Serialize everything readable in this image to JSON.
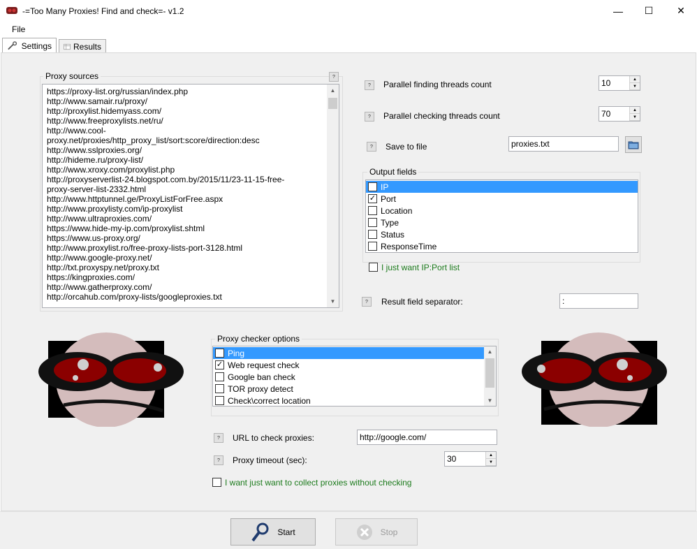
{
  "window": {
    "title": "-=Too Many Proxies! Find and check=- v1.2",
    "minimize": "—",
    "maximize": "☐",
    "close": "✕"
  },
  "menu": {
    "file": "File"
  },
  "tabs": [
    {
      "label": "Settings",
      "icon": "wrench-icon"
    },
    {
      "label": "Results",
      "icon": "table-icon"
    }
  ],
  "help_label": "?",
  "proxy_sources": {
    "label": "Proxy sources",
    "lines": [
      "https://proxy-list.org/russian/index.php",
      "http://www.samair.ru/proxy/",
      "http://proxylist.hidemyass.com/",
      "http://www.freeproxylists.net/ru/",
      "http://www.cool-",
      "proxy.net/proxies/http_proxy_list/sort:score/direction:desc",
      "http://www.sslproxies.org/",
      "http://hideme.ru/proxy-list/",
      "http://www.xroxy.com/proxylist.php",
      "http://proxyserverlist-24.blogspot.com.by/2015/11/23-11-15-free-",
      "proxy-server-list-2332.html",
      "http://www.httptunnel.ge/ProxyListForFree.aspx",
      "http://www.proxylisty.com/ip-proxylist",
      "http://www.ultraproxies.com/",
      "https://www.hide-my-ip.com/proxylist.shtml",
      "https://www.us-proxy.org/",
      "http://www.proxylist.ro/free-proxy-lists-port-3128.html",
      "http://www.google-proxy.net/",
      "http://txt.proxyspy.net/proxy.txt",
      "https://kingproxies.com/",
      "http://www.gatherproxy.com/",
      "http://orcahub.com/proxy-lists/googleproxies.txt"
    ]
  },
  "finding_threads": {
    "label": "Parallel finding threads count",
    "value": "10"
  },
  "checking_threads": {
    "label": "Parallel checking threads count",
    "value": "70"
  },
  "save_to_file": {
    "label": "Save to file",
    "value": "proxies.txt"
  },
  "output_fields": {
    "label": "Output fields",
    "items": [
      {
        "label": "IP",
        "checked": true,
        "selected": true
      },
      {
        "label": "Port",
        "checked": true,
        "selected": false
      },
      {
        "label": "Location",
        "checked": false,
        "selected": false
      },
      {
        "label": "Type",
        "checked": false,
        "selected": false
      },
      {
        "label": "Status",
        "checked": false,
        "selected": false
      },
      {
        "label": "ResponseTime",
        "checked": false,
        "selected": false
      }
    ]
  },
  "ip_port_only": {
    "label": "I just want IP:Port list",
    "checked": false
  },
  "separator": {
    "label": "Result field separator:",
    "value": ":"
  },
  "checker_options": {
    "label": "Proxy checker options",
    "items": [
      {
        "label": "Ping",
        "checked": false,
        "selected": true
      },
      {
        "label": "Web request check",
        "checked": true,
        "selected": false
      },
      {
        "label": "Google ban check",
        "checked": false,
        "selected": false
      },
      {
        "label": "TOR proxy detect",
        "checked": false,
        "selected": false
      },
      {
        "label": "Check\\correct location",
        "checked": false,
        "selected": false
      }
    ]
  },
  "url_check": {
    "label": "URL to check proxies:",
    "value": "http://google.com/"
  },
  "timeout": {
    "label": "Proxy timeout (sec):",
    "value": "30"
  },
  "collect_only": {
    "label": "I want just want to collect proxies without checking",
    "checked": false
  },
  "buttons": {
    "start": "Start",
    "stop": "Stop"
  },
  "colors": {
    "accent": "#3399ff",
    "green_text": "#1b7a1b",
    "mascot_red": "#8b0000"
  }
}
